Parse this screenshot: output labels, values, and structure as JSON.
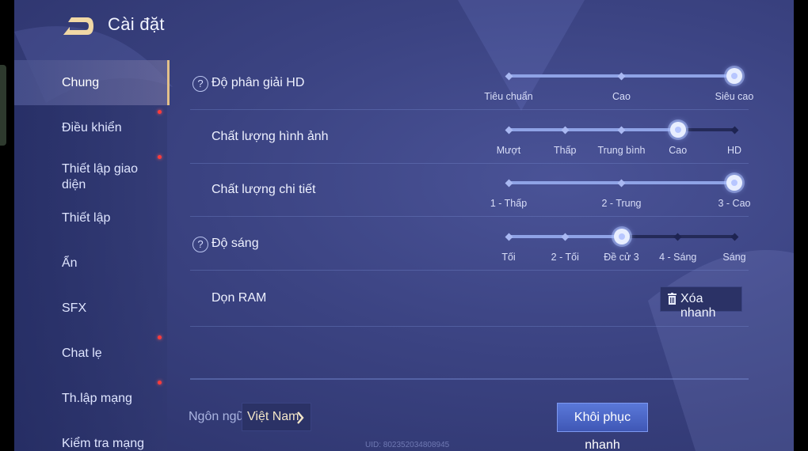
{
  "header": {
    "title": "Cài đặt",
    "back_icon": "back-arrow-icon"
  },
  "sidebar": {
    "items": [
      {
        "label": "Chung",
        "active": true,
        "badge": false
      },
      {
        "label": "Điều khiển",
        "active": false,
        "badge": true
      },
      {
        "label": "Thiết lập giao diện",
        "active": false,
        "badge": true
      },
      {
        "label": "Thiết lập",
        "active": false,
        "badge": false
      },
      {
        "label": "Ẩn",
        "active": false,
        "badge": false
      },
      {
        "label": "SFX",
        "active": false,
        "badge": false
      },
      {
        "label": "Chat lẹ",
        "active": false,
        "badge": true
      },
      {
        "label": "Th.lập mạng",
        "active": false,
        "badge": true
      },
      {
        "label": "Kiểm tra mạng",
        "active": false,
        "badge": false
      }
    ]
  },
  "settings": [
    {
      "label": "Độ phân giải HD",
      "help": true,
      "options": [
        "Tiêu chuẩn",
        "Cao",
        "Siêu cao"
      ],
      "selected_index": 2
    },
    {
      "label": "Chất lượng hình ảnh",
      "help": false,
      "options": [
        "Mượt",
        "Thấp",
        "Trung bình",
        "Cao",
        "HD"
      ],
      "selected_index": 3
    },
    {
      "label": "Chất lượng chi tiết",
      "help": false,
      "options": [
        "1 - Thấp",
        "2 - Trung",
        "3 - Cao"
      ],
      "selected_index": 2
    },
    {
      "label": "Độ sáng",
      "help": true,
      "options": [
        "Tối",
        "2 - Tối",
        "Đề cử 3",
        "4 - Sáng",
        "Sáng"
      ],
      "selected_index": 2
    }
  ],
  "ram": {
    "label": "Dọn RAM",
    "button_label": "Xóa nhanh",
    "icon": "trash-icon"
  },
  "footer": {
    "language_label": "Ngôn ngữ",
    "language_value": "Việt Nam",
    "restore_label": "Khôi phục nhanh",
    "uid": "UID: 802352034808945"
  },
  "colors": {
    "accent": "#e2c08a",
    "track": "#8fa3e6",
    "badge": "#ff3b3b",
    "button": "#4a66c8"
  }
}
